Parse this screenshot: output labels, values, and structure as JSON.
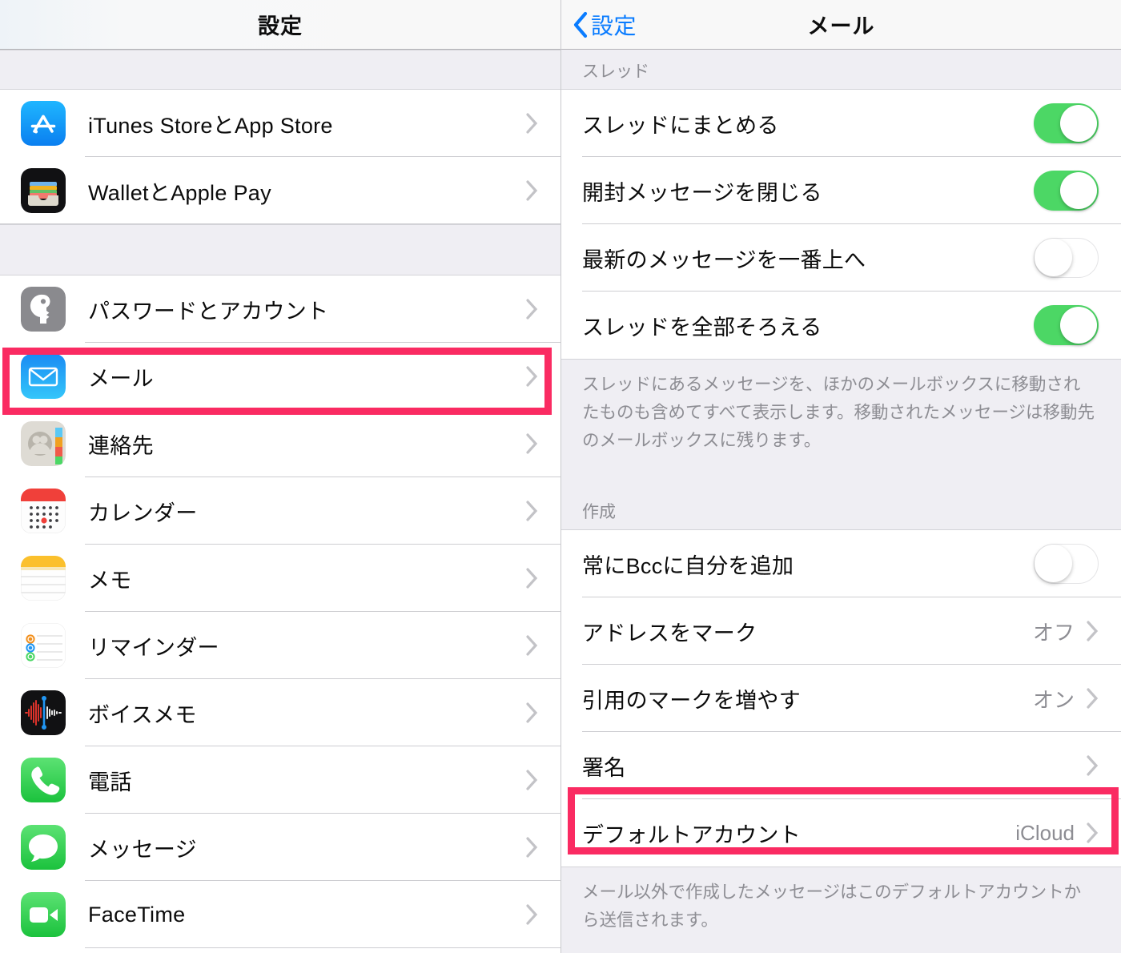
{
  "accent": {
    "highlight_pink": "#FA2B62",
    "toggle_green": "#4CD765",
    "link_blue": "#0A7CFF"
  },
  "left_panel": {
    "nav": {
      "title": "設定"
    },
    "groups": [
      {
        "rows": [
          {
            "label": "iTunes StoreとApp Store",
            "icon": "app-store-icon",
            "accessory": "chevron"
          },
          {
            "label": "WalletとApple Pay",
            "icon": "wallet-icon",
            "accessory": "chevron"
          }
        ]
      },
      {
        "rows": [
          {
            "label": "パスワードとアカウント",
            "icon": "key-icon",
            "accessory": "chevron"
          },
          {
            "label": "メール",
            "icon": "mail-icon",
            "accessory": "chevron",
            "highlighted": true
          },
          {
            "label": "連絡先",
            "icon": "contacts-icon",
            "accessory": "chevron"
          },
          {
            "label": "カレンダー",
            "icon": "calendar-icon",
            "accessory": "chevron"
          },
          {
            "label": "メモ",
            "icon": "notes-icon",
            "accessory": "chevron"
          },
          {
            "label": "リマインダー",
            "icon": "reminders-icon",
            "accessory": "chevron"
          },
          {
            "label": "ボイスメモ",
            "icon": "voice-memos-icon",
            "accessory": "chevron"
          },
          {
            "label": "電話",
            "icon": "phone-icon",
            "accessory": "chevron"
          },
          {
            "label": "メッセージ",
            "icon": "messages-icon",
            "accessory": "chevron"
          },
          {
            "label": "FaceTime",
            "icon": "facetime-icon",
            "accessory": "chevron"
          }
        ]
      }
    ]
  },
  "right_panel": {
    "nav": {
      "back_label": "設定",
      "back_icon": "chevron-left-icon",
      "title": "メール"
    },
    "thread_section": {
      "header": "スレッド",
      "rows": [
        {
          "label": "スレッドにまとめる",
          "control": "toggle",
          "on": true
        },
        {
          "label": "開封メッセージを閉じる",
          "control": "toggle",
          "on": true
        },
        {
          "label": "最新のメッセージを一番上へ",
          "control": "toggle",
          "on": false
        },
        {
          "label": "スレッドを全部そろえる",
          "control": "toggle",
          "on": true
        }
      ],
      "footnote": "スレッドにあるメッセージを、ほかのメールボックスに移動されたものも含めてすべて表示します。移動されたメッセージは移動先のメールボックスに残ります。"
    },
    "compose_section": {
      "header": "作成",
      "rows": [
        {
          "label": "常にBccに自分を追加",
          "control": "toggle",
          "on": false
        },
        {
          "label": "アドレスをマーク",
          "control": "value",
          "value": "オフ",
          "accessory": "chevron"
        },
        {
          "label": "引用のマークを増やす",
          "control": "value",
          "value": "オン",
          "accessory": "chevron"
        },
        {
          "label": "署名",
          "control": "value",
          "value": "",
          "accessory": "chevron"
        },
        {
          "label": "デフォルトアカウント",
          "control": "value",
          "value": "iCloud",
          "accessory": "chevron",
          "highlighted": true
        }
      ],
      "footnote": "メール以外で作成したメッセージはこのデフォルトアカウントから送信されます。"
    }
  }
}
